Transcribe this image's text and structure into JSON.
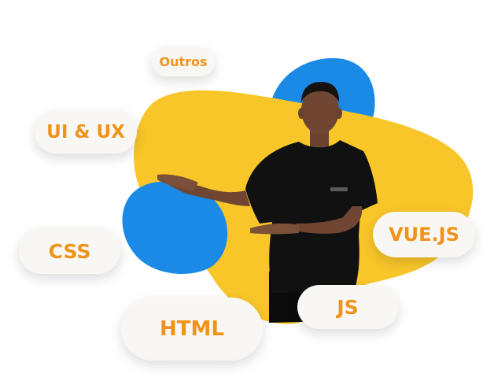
{
  "skills": {
    "outros": "Outros",
    "ui_ux": "UI & UX",
    "css": "CSS",
    "vue_js": "VUE.JS",
    "js": "JS",
    "html": "HTML"
  },
  "colors": {
    "yellow_blob": "#f8c629",
    "blue_blob": "#1a8ae6",
    "pill_background": "#f8f7f4",
    "pill_text": "#f0931a",
    "shirt": "#111111",
    "skin": "#6e4632"
  }
}
